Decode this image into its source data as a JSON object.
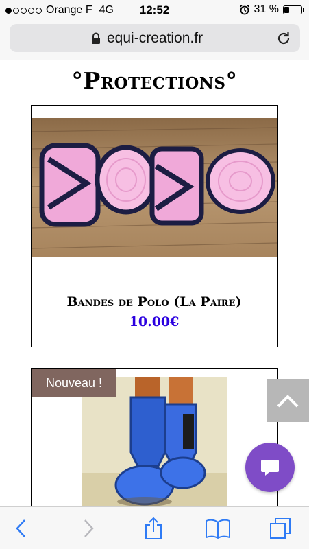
{
  "status_bar": {
    "carrier": "Orange F",
    "network": "4G",
    "time": "12:52",
    "battery_percent": "31 %",
    "battery_level": 0.31,
    "signal_bars": 1
  },
  "address_bar": {
    "url": "equi-creation.fr",
    "secure": true
  },
  "page": {
    "title": "°Protections°",
    "products": [
      {
        "name": "Bandes de Polo (La Paire)",
        "price": "10.00€",
        "badge": ""
      },
      {
        "name": "",
        "price": "",
        "badge": "Nouveau !"
      }
    ]
  },
  "colors": {
    "price": "#2b00e0",
    "badge_bg": "#80665f",
    "chat_button": "#7f4cc7",
    "toolbar_icons": "#2f7bf5"
  },
  "icons": {
    "lock": "lock-icon",
    "reload": "reload-icon",
    "scroll_top": "chevron-up-icon",
    "chat": "chat-bubble-icon",
    "back": "back-chevron-icon",
    "forward": "forward-chevron-icon",
    "share": "share-icon",
    "bookmarks": "book-icon",
    "tabs": "tabs-icon"
  }
}
